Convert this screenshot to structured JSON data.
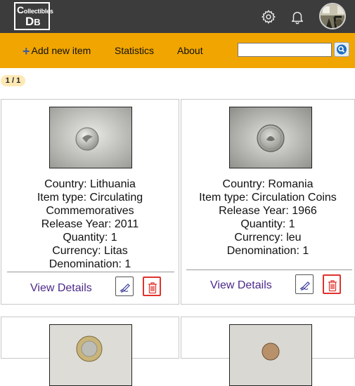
{
  "header": {
    "logo_line1_first": "C",
    "logo_line1_rest": "ollectibles",
    "logo_line2_first": "D",
    "logo_line2_rest": "B",
    "icons": [
      "gear-icon",
      "bell-icon",
      "avatar"
    ]
  },
  "nav": {
    "add_label": "Add new item",
    "stats_label": "Statistics",
    "about_label": "About",
    "search_value": "",
    "search_placeholder": ""
  },
  "pagination": {
    "label": "1 / 1"
  },
  "items": [
    {
      "country": "Country: Lithuania",
      "type_line1": "Item type: Circulating",
      "type_line2": "Commemoratives",
      "year": "Release Year: 2011",
      "quantity": "Quantity: 1",
      "currency": "Currency: Litas",
      "denomination": "Denomination: 1",
      "view_label": "View Details"
    },
    {
      "country": "Country: Romania",
      "type_line1": "Item type: Circulation Coins",
      "year": "Release Year: 1966",
      "quantity": "Quantity: 1",
      "currency": "Currency: leu",
      "denomination": "Denomination: 1",
      "view_label": "View Details"
    }
  ],
  "colors": {
    "topbar": "#3c3c3c",
    "navbar": "#f0a500",
    "link": "#4b2a8a",
    "delete": "#e0322d"
  }
}
